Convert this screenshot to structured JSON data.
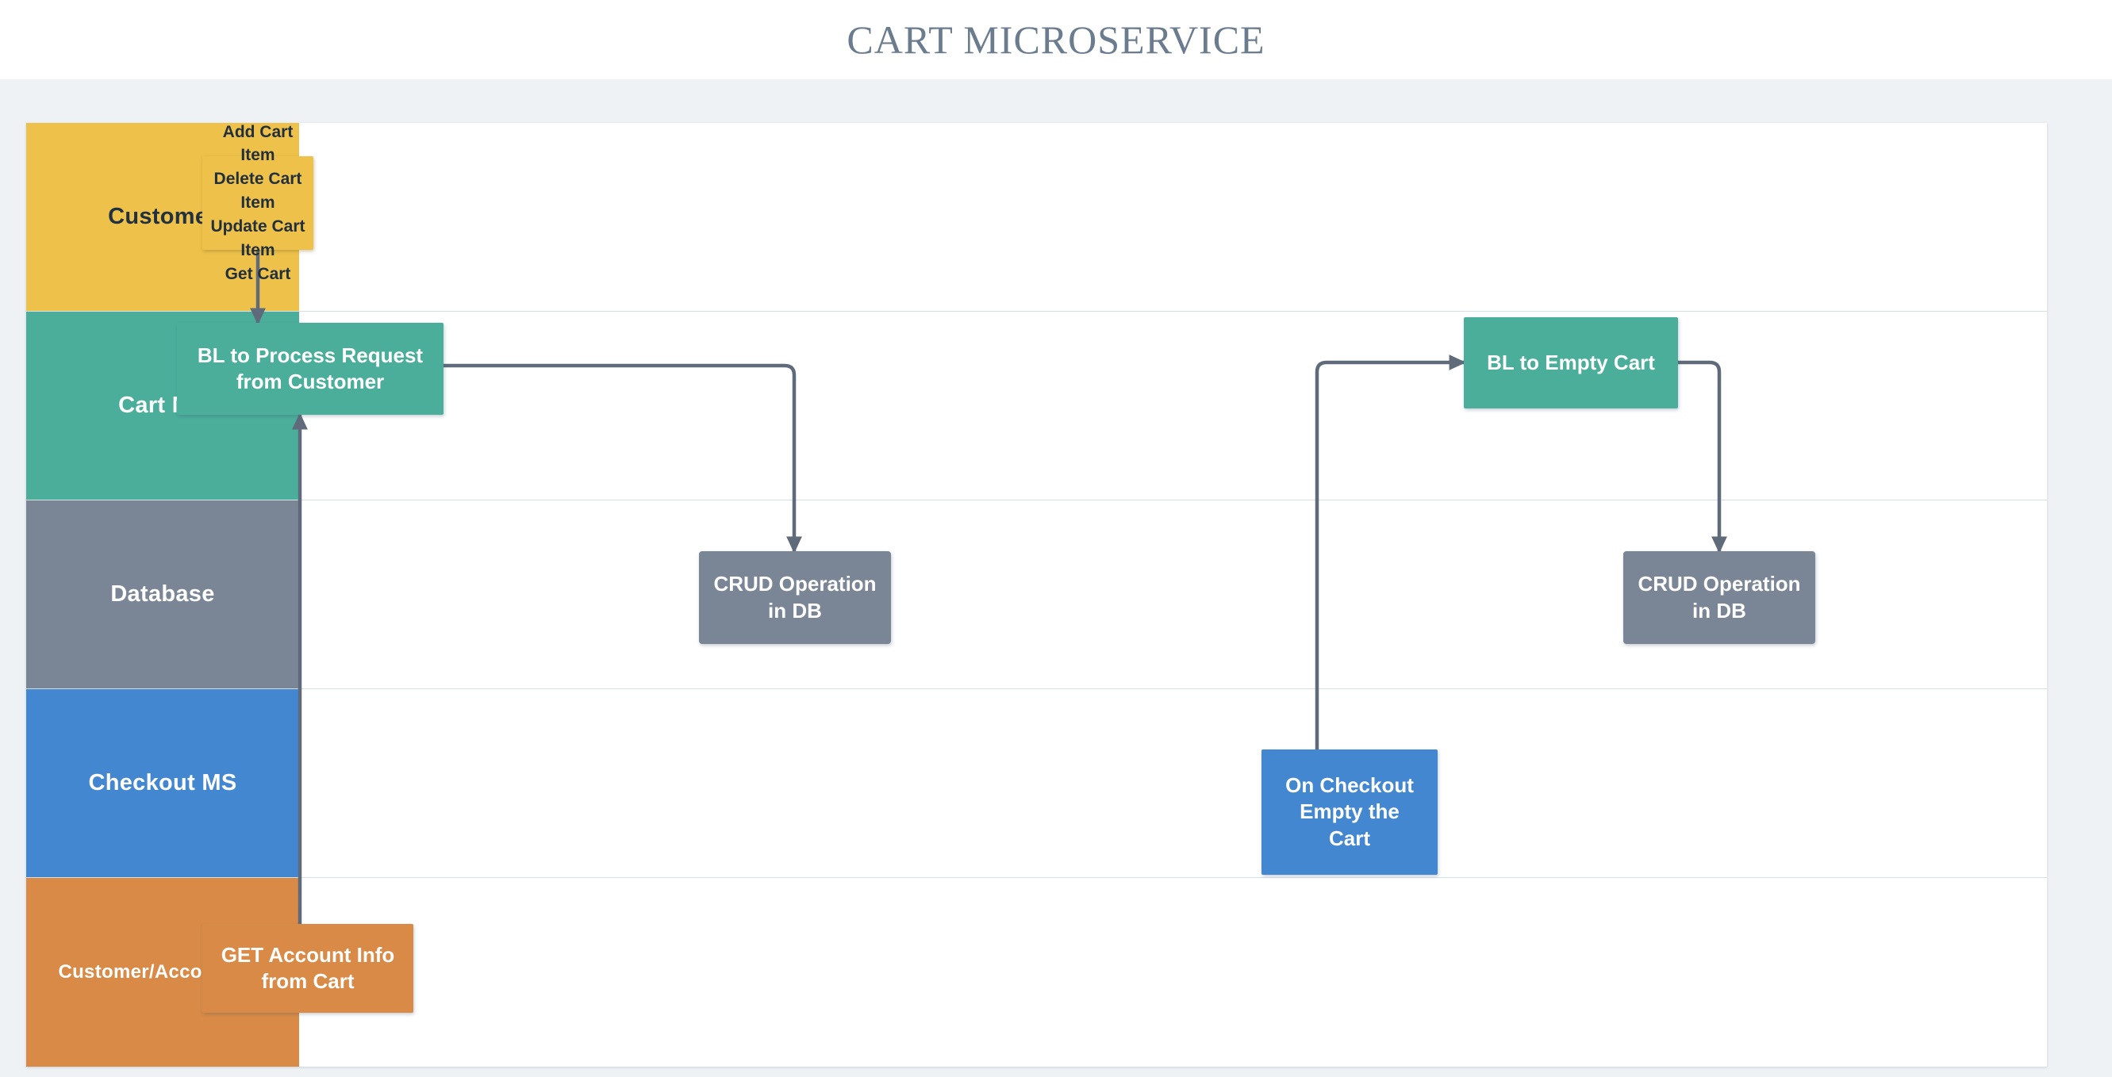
{
  "page": {
    "title": "CART MICROSERVICE",
    "background_color": "#eef2f5",
    "canvas_color": "#ffffff",
    "title_color": "#6b7c8f"
  },
  "diagram": {
    "type": "swimlane-flowchart",
    "lanes": [
      {
        "id": "customer",
        "label": "Customer",
        "color": "#edc14a",
        "text_color": "#22313f"
      },
      {
        "id": "cart-ms",
        "label": "Cart MS",
        "color": "#4bae9b",
        "text_color": "#ffffff"
      },
      {
        "id": "database",
        "label": "Database",
        "color": "#7a8595",
        "text_color": "#ffffff"
      },
      {
        "id": "checkout-ms",
        "label": "Checkout MS",
        "color": "#4387d1",
        "text_color": "#ffffff"
      },
      {
        "id": "account-ms",
        "label": "Customer/Account MS",
        "color": "#d98a46",
        "text_color": "#ffffff"
      }
    ],
    "nodes": [
      {
        "id": "customer-requests",
        "lane": "customer",
        "color": "#edc14a",
        "lines": [
          "Add Cart Item",
          "Delete Cart Item",
          "Update Cart Item",
          "Get Cart"
        ]
      },
      {
        "id": "bl-process-request",
        "lane": "cart-ms",
        "color": "#4bae9b",
        "lines": [
          "BL to Process Request",
          "from Customer"
        ]
      },
      {
        "id": "bl-empty-cart",
        "lane": "cart-ms",
        "color": "#4bae9b",
        "lines": [
          "BL to Empty Cart"
        ]
      },
      {
        "id": "crud-left",
        "lane": "database",
        "color": "#7a8595",
        "lines": [
          "CRUD Operation",
          "in DB"
        ]
      },
      {
        "id": "crud-right",
        "lane": "database",
        "color": "#7a8595",
        "lines": [
          "CRUD Operation",
          "in DB"
        ]
      },
      {
        "id": "on-checkout-empty",
        "lane": "checkout-ms",
        "color": "#4387d1",
        "lines": [
          "On Checkout",
          "Empty the",
          "Cart"
        ]
      },
      {
        "id": "get-account-info",
        "lane": "account-ms",
        "color": "#d98a46",
        "lines": [
          "GET Account Info",
          "from Cart"
        ]
      }
    ],
    "connectors": [
      {
        "id": "customer-to-cart",
        "from": "customer-requests",
        "to": "bl-process-request",
        "direction": "down"
      },
      {
        "id": "cart-to-crud-left",
        "from": "bl-process-request",
        "to": "crud-left",
        "direction": "right-down"
      },
      {
        "id": "checkout-to-empty",
        "from": "on-checkout-empty",
        "to": "bl-empty-cart",
        "direction": "up-right"
      },
      {
        "id": "empty-to-crud-right",
        "from": "bl-empty-cart",
        "to": "crud-right",
        "direction": "right-down"
      },
      {
        "id": "account-to-cart",
        "from": "get-account-info",
        "to": "bl-process-request",
        "direction": "up"
      }
    ],
    "connector_color": "#5f6b7a"
  }
}
